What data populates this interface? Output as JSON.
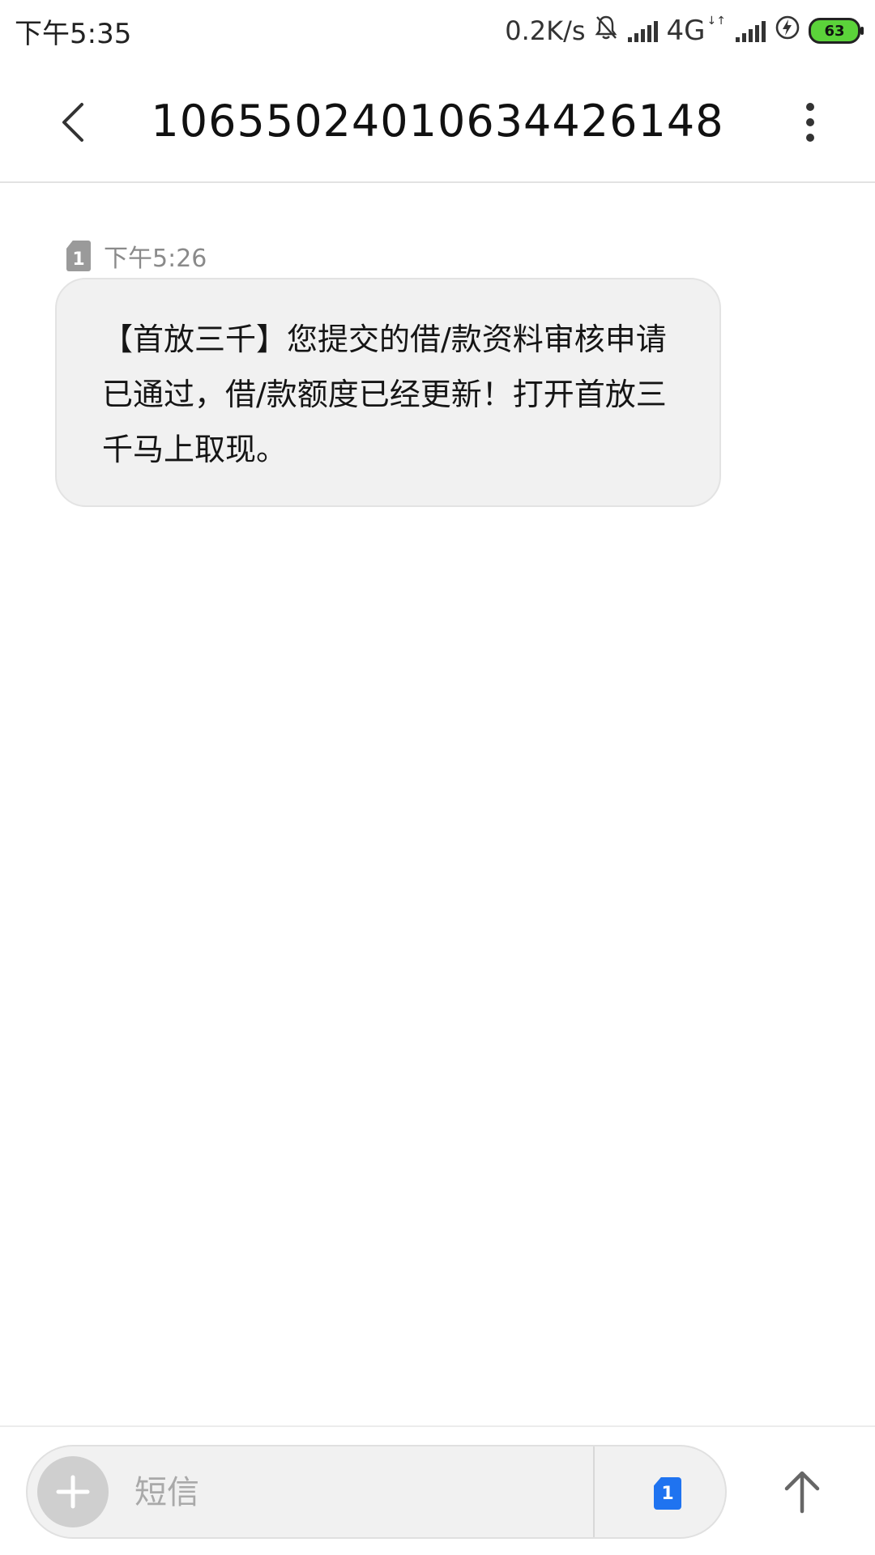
{
  "status_bar": {
    "time": "下午5:35",
    "net_speed": "0.2K/s",
    "network_type": "4G",
    "battery_level": "63",
    "icons": [
      "bell-off-icon",
      "signal-icon",
      "signal-icon",
      "charging-icon",
      "battery-icon"
    ]
  },
  "header": {
    "title": "10655024010634426148",
    "back_icon": "chevron-left-icon",
    "more_icon": "more-vertical-icon"
  },
  "message": {
    "sim_slot": "1",
    "time": "下午5:26",
    "text": "【首放三千】您提交的借/款资料审核申请已通过，借/款额度已经更新！打开首放三千马上取现。"
  },
  "composer": {
    "placeholder": "短信",
    "sim_slot": "1",
    "add_icon": "plus-icon",
    "send_icon": "arrow-up-icon"
  },
  "colors": {
    "bubble_bg": "#f1f1f1",
    "sim_accent": "#1f73f0",
    "battery_fill": "#5bd33a"
  }
}
